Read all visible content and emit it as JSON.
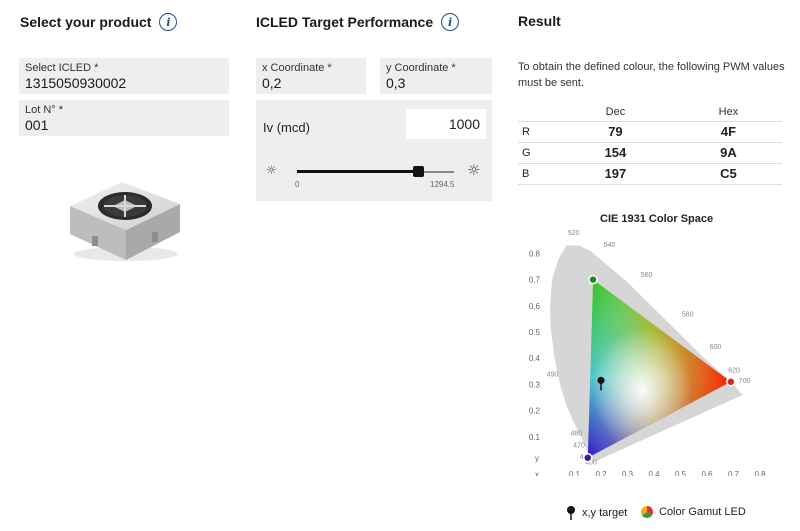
{
  "product": {
    "title": "Select your product",
    "icled_label": "Select ICLED *",
    "icled_value": "1315050930002",
    "lot_label": "Lot N° *",
    "lot_value": "001"
  },
  "target": {
    "title": "ICLED Target Performance",
    "x_label": "x Coordinate *",
    "x_value": "0,2",
    "y_label": "y Coordinate *",
    "y_value": "0,3",
    "iv_label": "Iv (mcd)",
    "iv_value": "1000",
    "slider_min": "0",
    "slider_max": "1294.5",
    "slider_fraction": 0.773
  },
  "result": {
    "title": "Result",
    "description": "To obtain the defined colour, the following PWM values must be sent.",
    "col_dec": "Dec",
    "col_hex": "Hex",
    "rows": [
      {
        "channel": "R",
        "dec": "79",
        "hex": "4F"
      },
      {
        "channel": "G",
        "dec": "154",
        "hex": "9A"
      },
      {
        "channel": "B",
        "dec": "197",
        "hex": "C5"
      }
    ]
  },
  "cie": {
    "title": "CIE 1931 Color Space",
    "x_axis_label": "x",
    "y_axis_label": "y",
    "x_ticks": [
      "0.1",
      "0.2",
      "0.3",
      "0.4",
      "0.5",
      "0.6",
      "0.7",
      "0.8"
    ],
    "y_ticks": [
      "0.1",
      "0.2",
      "0.3",
      "0.4",
      "0.5",
      "0.6",
      "0.7",
      "0.8"
    ],
    "wavelengths": [
      "520",
      "540",
      "560",
      "580",
      "600",
      "620",
      "700",
      "490",
      "480",
      "470",
      "450",
      "400"
    ],
    "target_point": {
      "x": 0.2,
      "y": 0.3
    },
    "gamut": {
      "red": {
        "x": 0.69,
        "y": 0.31
      },
      "green": {
        "x": 0.17,
        "y": 0.7
      },
      "blue": {
        "x": 0.15,
        "y": 0.02
      }
    },
    "legend_target": "x,y target",
    "legend_gamut": "Color Gamut LED"
  }
}
